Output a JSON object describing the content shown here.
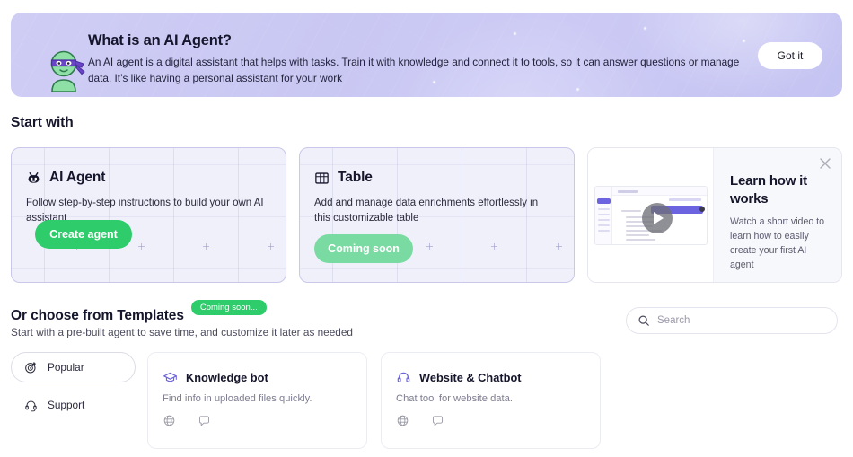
{
  "banner": {
    "mascot_icon": "ninja-agent-mascot",
    "title": "What is an AI Agent?",
    "body": "An AI agent is a digital assistant that helps with tasks. Train it with knowledge and connect it to tools, so it can answer questions or manage data. It’s like having a personal assistant for your work",
    "dismiss_label": "Got it",
    "bg_color": "#cbcaf4"
  },
  "start_section": {
    "heading": "Start with",
    "cards": [
      {
        "icon": "robot-head-icon",
        "title": "AI Agent",
        "description": "Follow step-by-step instructions to build your own AI assistant",
        "button_label": "Create agent",
        "button_color": "#2ecc6b",
        "button_enabled": true
      },
      {
        "icon": "table-grid-icon",
        "title": "Table",
        "description": "Add and manage data enrichments effortlessly in this customizable table",
        "button_label": "Coming soon",
        "button_color": "#7adba2",
        "button_enabled": false
      }
    ]
  },
  "learn_card": {
    "title": "Learn how it works",
    "description": "Watch a short video to learn how to easily create your first AI agent",
    "play_icon": "play-icon",
    "close_icon": "close-icon"
  },
  "templates_section": {
    "heading": "Or choose from Templates",
    "badge": "Coming soon...",
    "badge_color": "#2ecc6b",
    "subheading": "Start with a pre-built agent to save time, and customize it later as needed",
    "search": {
      "icon": "search-icon",
      "placeholder": "Search",
      "value": ""
    },
    "categories": [
      {
        "icon": "target-icon",
        "label": "Popular",
        "active": true
      },
      {
        "icon": "headset-icon",
        "label": "Support",
        "active": false
      }
    ],
    "cards": [
      {
        "icon": "graduation-cap-icon",
        "title": "Knowledge bot",
        "description": "Find info in uploaded files quickly.",
        "tool_icons": [
          "globe-icon",
          "chat-bubble-icon"
        ]
      },
      {
        "icon": "headset-icon",
        "title": "Website & Chatbot",
        "description": "Chat tool for website data.",
        "tool_icons": [
          "globe-icon",
          "chat-bubble-icon"
        ]
      }
    ]
  }
}
